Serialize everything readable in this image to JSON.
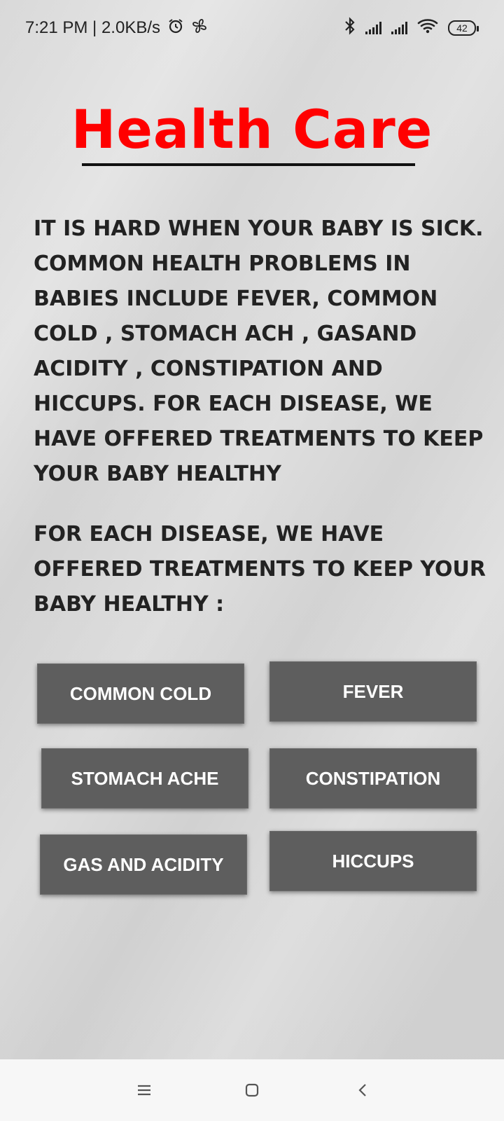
{
  "status_bar": {
    "time_speed": "7:21 PM | 2.0KB/s",
    "battery": "42",
    "icons": [
      "alarm-icon",
      "fan-icon",
      "bluetooth-icon",
      "signal-icon",
      "signal-icon",
      "wifi-icon",
      "battery-icon"
    ]
  },
  "title": "Health Care",
  "colors": {
    "title": "#ff0000",
    "button_bg": "#5e5e5e",
    "text": "#222222"
  },
  "intro": "IT IS HARD WHEN YOUR BABY IS SICK. COMMON HEALTH PROBLEMS IN BABIES INCLUDE FEVER, COMMON COLD , STOMACH ACH , GASAND ACIDITY , CONSTIPATION AND HICCUPS. FOR EACH DISEASE, WE HAVE OFFERED TREATMENTS TO KEEP YOUR BABY HEALTHY",
  "prompt": "FOR EACH DISEASE, WE HAVE OFFERED TREATMENTS TO KEEP YOUR BABY HEALTHY :",
  "buttons": {
    "common_cold": "COMMON COLD",
    "fever": "FEVER",
    "stomach_ache": "STOMACH ACHE",
    "constipation": "CONSTIPATION",
    "gas_acidity": "GAS AND ACIDITY",
    "hiccups": "HICCUPS"
  },
  "nav_bar": {
    "icons": [
      "menu-icon",
      "home-icon",
      "back-icon"
    ]
  }
}
